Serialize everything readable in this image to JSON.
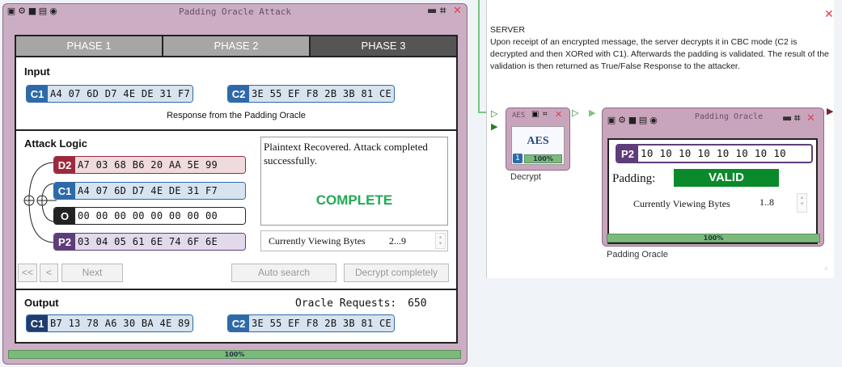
{
  "main": {
    "title": "Padding Oracle Attack",
    "phases": [
      "PHASE 1",
      "PHASE 2",
      "PHASE 3"
    ],
    "active_phase": 3,
    "input": {
      "title": "Input",
      "c1_tag": "C1",
      "c1_bytes": "A4 07 6D D7 4E DE 31 F7",
      "c2_tag": "C2",
      "c2_bytes": "3E 55 EF F8 2B 3B 81 CE",
      "response_label": "Response from the Padding Oracle"
    },
    "attack": {
      "title": "Attack Logic",
      "d2_tag": "D2",
      "d2_bytes": "A7 03 68 B6 20 AA 5E 99",
      "c1_tag": "C1",
      "c1_bytes": "A4 07 6D D7 4E DE 31 F7",
      "o_tag": "O",
      "o_bytes": "00 00 00 00 00 00 00 00",
      "p2_tag": "P2",
      "p2_bytes": "03 04 05 61 6E 74 6F 6E",
      "status_text": "Plaintext Recovered. Attack completed successfully.",
      "status_word": "COMPLETE",
      "viewing_label": "Currently Viewing Bytes",
      "viewing_range": "2...9"
    },
    "buttons": {
      "first": "<<",
      "prev": "<",
      "next": "Next",
      "auto": "Auto search",
      "decrypt": "Decrypt completely"
    },
    "output": {
      "title": "Output",
      "requests_label": "Oracle Requests:",
      "requests_value": "650",
      "c1_tag": "C1",
      "c1_bytes": "B7 13 78 A6 30 BA 4E 89",
      "c2_tag": "C2",
      "c2_bytes": "3E 55 EF F8 2B 3B 81 CE"
    },
    "progress_text": "100%",
    "progress_value": 1.0
  },
  "server": {
    "title": "SERVER",
    "description": "Upon receipt of an encrypted message, the server decrypts it in CBC mode (C2 is decrypted and then XORed with C1). Afterwards the padding is validated. The result of the validation is then returned as True/False Response to the attacker."
  },
  "aes": {
    "title": "AES",
    "icon_text": "AES",
    "badge": "1",
    "progress_text": "100%",
    "caption": "Decrypt"
  },
  "oracle": {
    "title": "Padding Oracle",
    "p2_tag": "P2",
    "p2_bytes": "10 10 10 10 10 10 10 10",
    "padding_label": "Padding:",
    "padding_state": "VALID",
    "viewing_label": "Currently Viewing Bytes",
    "viewing_range": "1..8",
    "progress_text": "100%",
    "caption": "Padding Oracle"
  },
  "colors": {
    "complete": "#22aa55",
    "valid_bg": "#0a8a2a",
    "progress": "#7bba7b"
  },
  "icons": [
    "image-icon",
    "gear-icon",
    "stop-icon",
    "document-icon",
    "help-icon",
    "minimize-icon",
    "maximize-icon",
    "close-icon",
    "connector-arrow-icon"
  ]
}
